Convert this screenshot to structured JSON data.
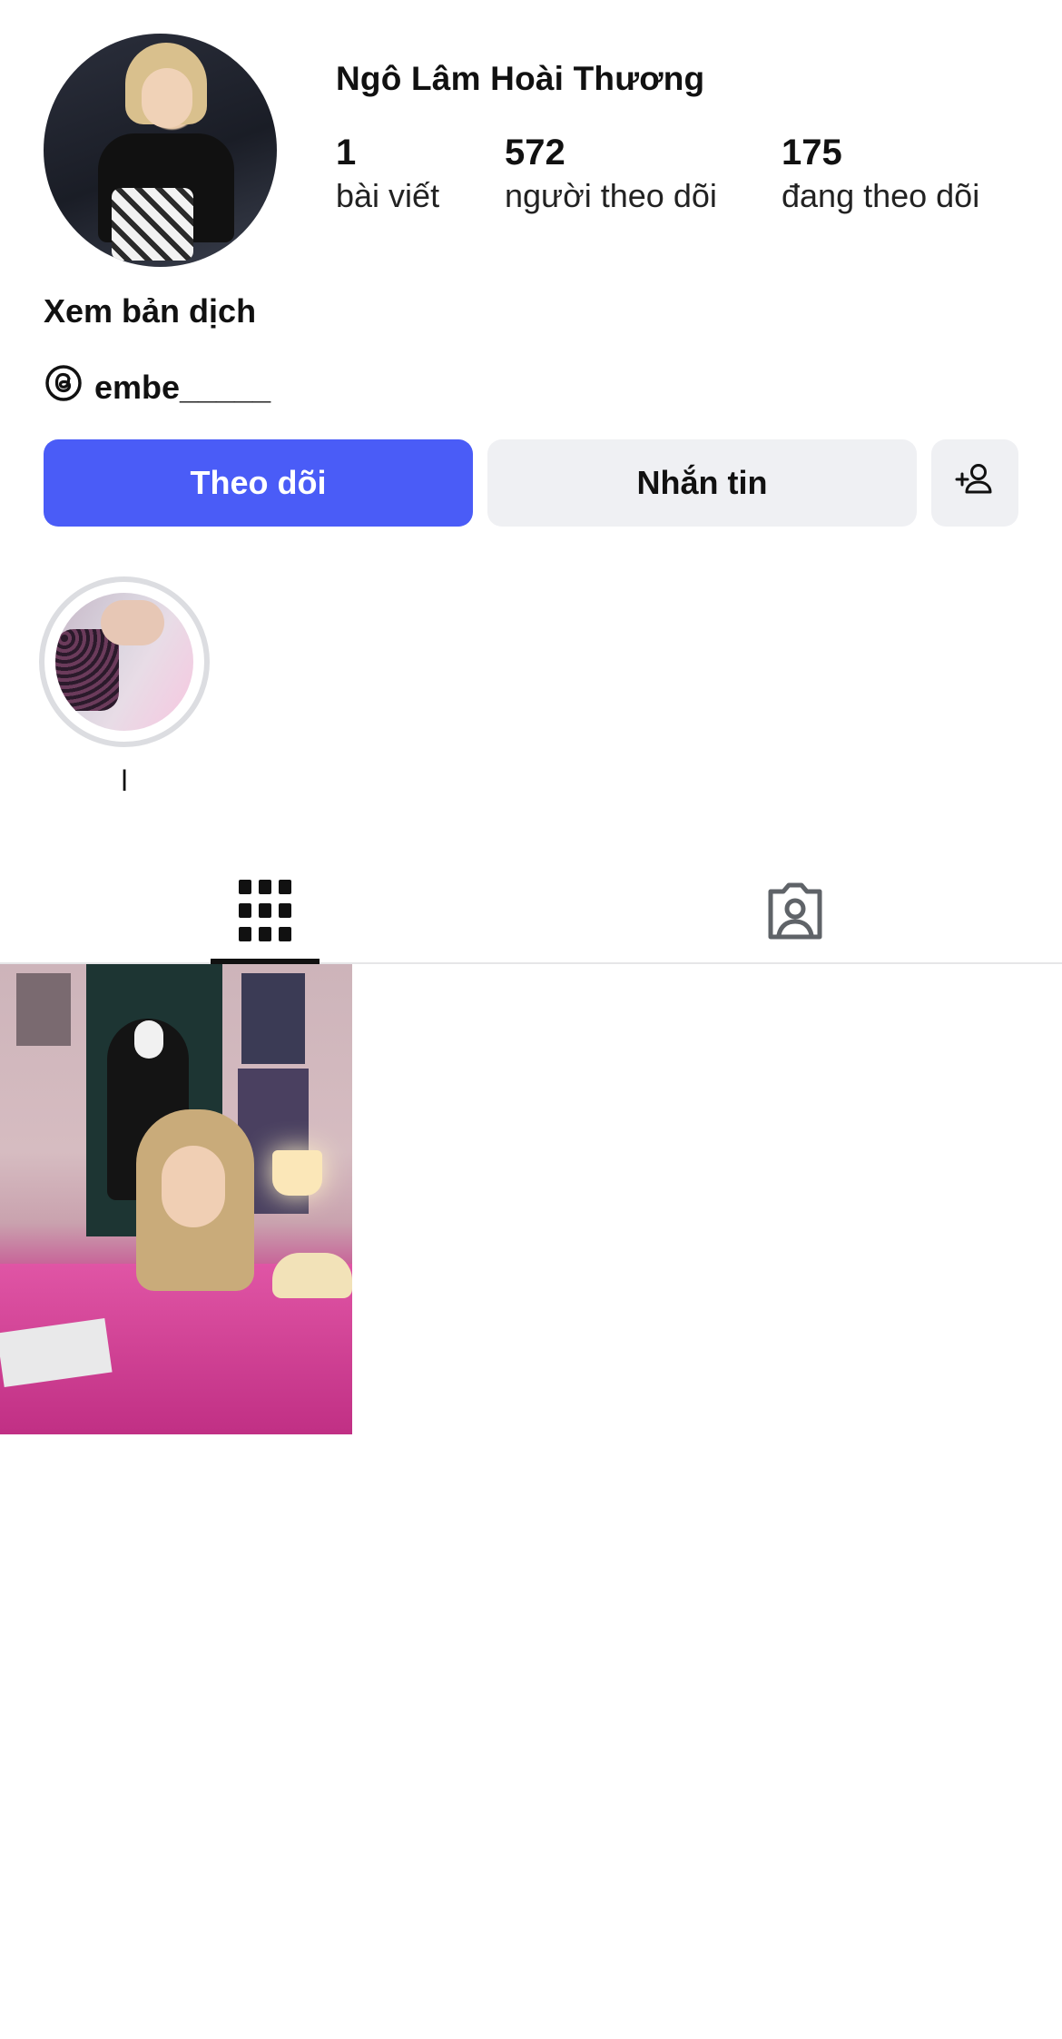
{
  "profile": {
    "name": "Ngô Lâm Hoài Thương",
    "stats": [
      {
        "num": "1",
        "label": "bài viết"
      },
      {
        "num": "572",
        "label": "người theo dõi"
      },
      {
        "num": "175",
        "label": "đang theo dõi"
      }
    ],
    "translate_link": "Xem bản dịch",
    "threads_handle": "embe_____"
  },
  "actions": {
    "follow": "Theo dõi",
    "message": "Nhắn tin"
  },
  "highlights": [
    {
      "label": "l"
    }
  ],
  "tabs": {
    "active": "grid",
    "items": [
      "grid-icon",
      "tagged-icon"
    ]
  },
  "colors": {
    "follow_button": "#4a5cf7",
    "secondary_button": "#eff0f3"
  }
}
